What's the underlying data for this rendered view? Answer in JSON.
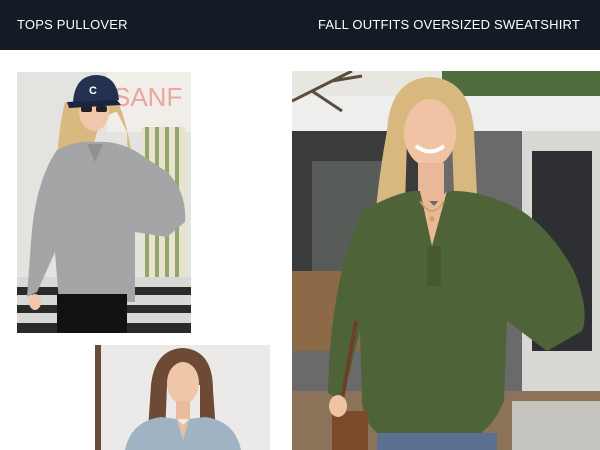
{
  "header": {
    "left_label": "TOPS PULLOVER",
    "right_label": "FALL OUTFITS OVERSIZED SWEATSHIRT"
  },
  "photos": {
    "grey_pullover": {
      "sign_text": "SANF",
      "cap_letter": "C"
    }
  },
  "colors": {
    "header_bg": "#131c24",
    "grey_sweater": "#a3a5a7",
    "olive_sweater": "#4f6339",
    "denim_shirt": "#9fb3c5"
  }
}
